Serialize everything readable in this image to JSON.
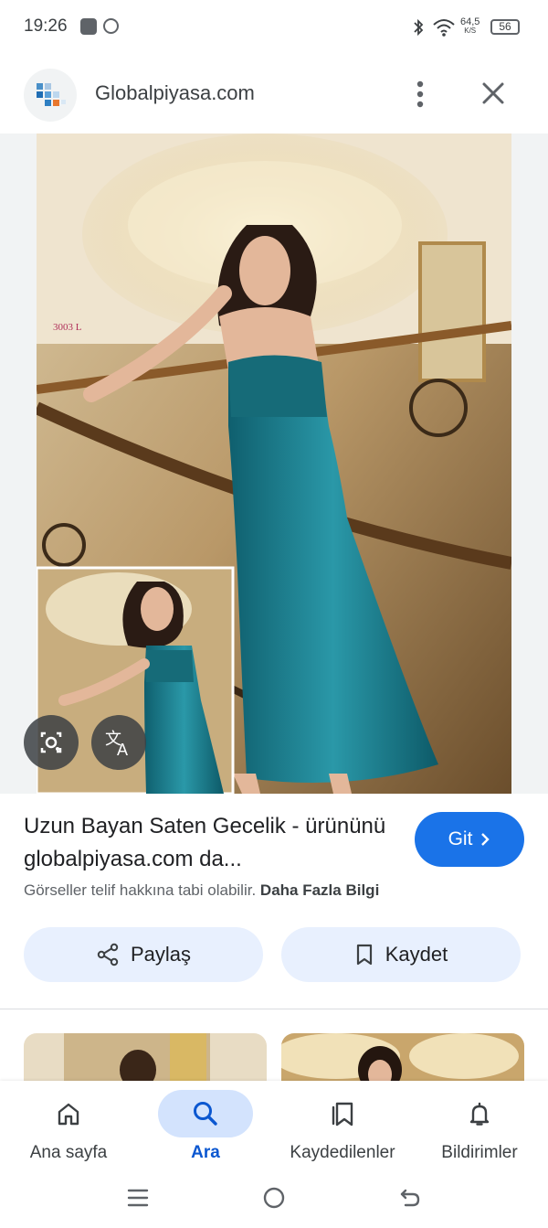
{
  "status_bar": {
    "time": "19:26",
    "net_speed_value": "64,5",
    "net_speed_unit": "K/S",
    "battery": "56"
  },
  "header": {
    "site": "Globalpiyasa.com"
  },
  "result": {
    "title": "Uzun Bayan Saten Gecelik - ürününü globalpiyasa.com da...",
    "go_label": "Git",
    "copyright_text": "Görseller telif hakkına tabi olabilir.",
    "learn_more": "Daha Fazla Bilgi",
    "share_label": "Paylaş",
    "save_label": "Kaydet"
  },
  "bottom_nav": {
    "items": [
      {
        "label": "Ana sayfa",
        "icon": "home-icon"
      },
      {
        "label": "Ara",
        "icon": "search-icon"
      },
      {
        "label": "Kaydedilenler",
        "icon": "saved-icon"
      },
      {
        "label": "Bildirimler",
        "icon": "bell-icon"
      }
    ],
    "active": "Ara"
  },
  "colors": {
    "accent": "#1a73e8",
    "pill_bg": "#e8f0fe",
    "dress_teal": "#1c7f8e",
    "nav_active_bg": "#d3e3fd"
  }
}
